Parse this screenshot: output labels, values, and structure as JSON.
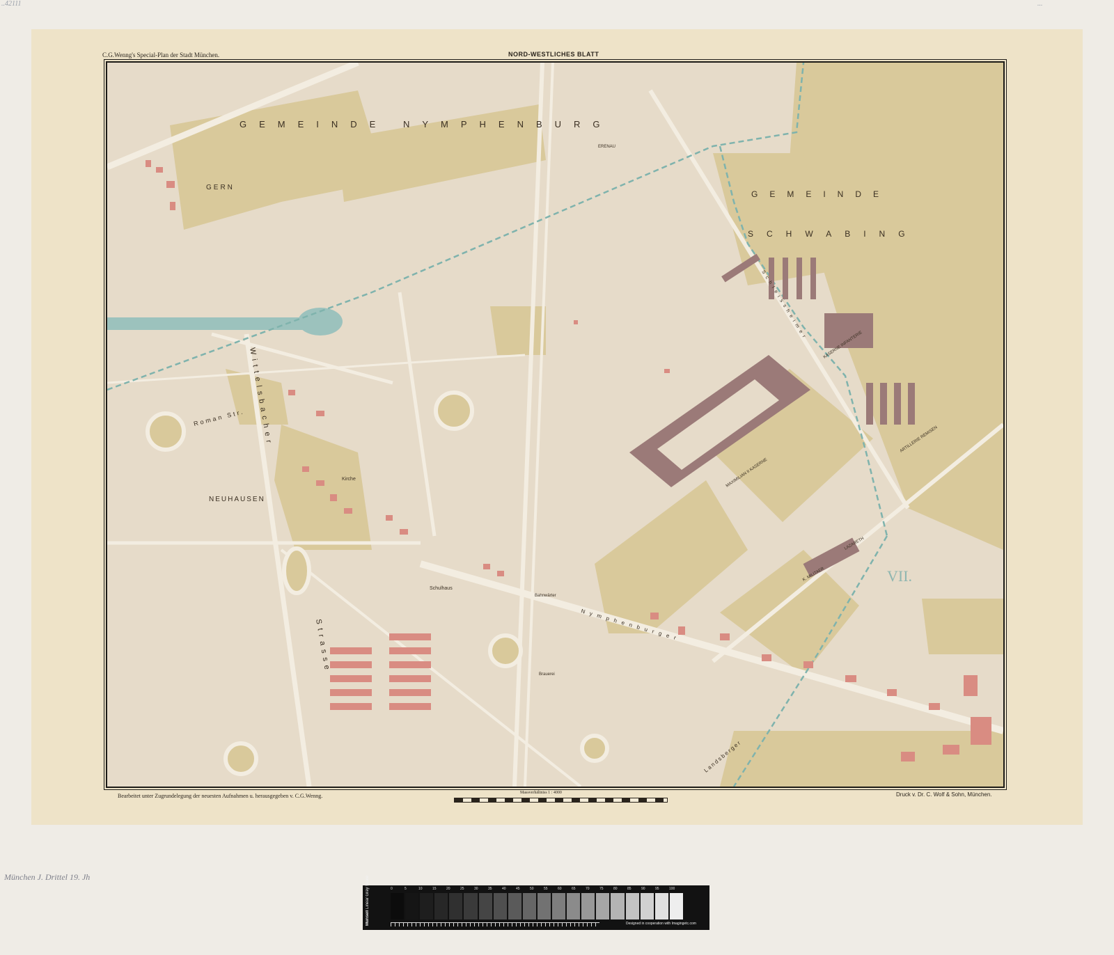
{
  "header": {
    "left_title": "C.G.Wenng's Special-Plan der Stadt München.",
    "sheet_title": "NORD-WESTLICHES BLATT"
  },
  "top_corner_note_left": "..42111",
  "top_corner_note_right": "...",
  "map": {
    "districts": {
      "nymphenburg": "GEMEINDE   NYMPHENBURG",
      "schwabing_1": "GEMEINDE",
      "schwabing_2": "SCHWABING",
      "gern": "GERN",
      "neuhausen": "NEUHAUSEN",
      "sheet_number": "VII."
    },
    "streets": {
      "wittelsbacher": "Wittelsbacher",
      "romanstr": "Roman Str.",
      "nymphenburger": "Nymphenburger",
      "strasse": "Strasse",
      "schleissheimer": "Schleissheimer",
      "landsberger": "Landsberger"
    },
    "buildings": {
      "kirche": "Kirche",
      "schulhaus": "Schulhaus",
      "bahnwaerter": "Bahnwärter",
      "brauerei": "Brauerei",
      "max_kaserne": "MAXIMILIAN II KASERNE",
      "infanterie": "KASERNE INFANTERIE",
      "artillerie": "ARTILLERIE REMISEN",
      "lazareth": "LAZARETH",
      "militaer": "K. MILITAER",
      "erenau": "ERENAU"
    },
    "colors": {
      "paper": "#eee3c8",
      "map_ground": "#e6dbc9",
      "field": "#d9c99b",
      "houses": "#d98c82",
      "barracks": "#9b7a78",
      "water": "#9cc2bd",
      "boundary": "#7fb3ad",
      "roads": "#f3ede1"
    }
  },
  "footer": {
    "left": "Bearbeitet unter Zugrundelegung der neuesten Aufnahmen u. herausgegeben v. C.G.Wenng.",
    "scale_title": "Massverhältniss 1 : 4000",
    "right": "Druck v. Dr. C. Wolf & Sohn, München."
  },
  "margin_note": "München J. Drittel 19. Jh",
  "color_card": {
    "brand": "Munsell",
    "subtitle": "Linear Gray Scale",
    "numbers": [
      "0",
      "5",
      "10",
      "15",
      "20",
      "25",
      "30",
      "35",
      "40",
      "45",
      "50",
      "55",
      "60",
      "65",
      "70",
      "75",
      "80",
      "85",
      "90",
      "95",
      "100"
    ],
    "patches": [
      "#0c0c0c",
      "#151515",
      "#1e1e1e",
      "#272727",
      "#303030",
      "#3a3a3a",
      "#454545",
      "#4f4f4f",
      "#5a5a5a",
      "#666666",
      "#727272",
      "#7e7e7e",
      "#8b8b8b",
      "#989898",
      "#a6a6a6",
      "#b4b4b4",
      "#c3c3c3",
      "#d1d1d1",
      "#e0e0e0",
      "#eeeeee"
    ],
    "credit": "Designed in cooperation with Imagingetc.com"
  }
}
